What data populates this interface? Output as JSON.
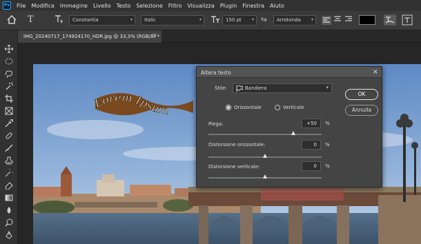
{
  "app_logo": "Ps",
  "menu": [
    "File",
    "Modifica",
    "Immagine",
    "Livello",
    "Testo",
    "Selezione",
    "Filtro",
    "Visualizza",
    "Plugin",
    "Finestra",
    "Aiuto"
  ],
  "options": {
    "font_family": "Constantia",
    "font_style": "Italic",
    "font_size": "150 pt",
    "aa_label": "ªa",
    "antialias": "Arrotonda",
    "color_swatch": "#000000"
  },
  "document": {
    "tab_title": "IMG_20240717_174924170_HDR.jpg @ 33,3% (RGB/8) *",
    "tab_close": "×"
  },
  "warped_text": "Lorem Ipsum",
  "dialog": {
    "title": "Altera testo",
    "close": "×",
    "style_label": "Stile:",
    "style_value": "Bandiera",
    "ok": "OK",
    "cancel": "Annulla",
    "orientation_h": "Orizzontale",
    "orientation_v": "Verticale",
    "bend_label": "Piega:",
    "bend_value": "+50",
    "hdist_label": "Distorsione orizzontale:",
    "hdist_value": "0",
    "vdist_label": "Distorsione verticale:",
    "vdist_value": "0",
    "percent": "%",
    "bend_level": 0.75,
    "hdist_level": 0.5,
    "vdist_level": 0.5
  }
}
